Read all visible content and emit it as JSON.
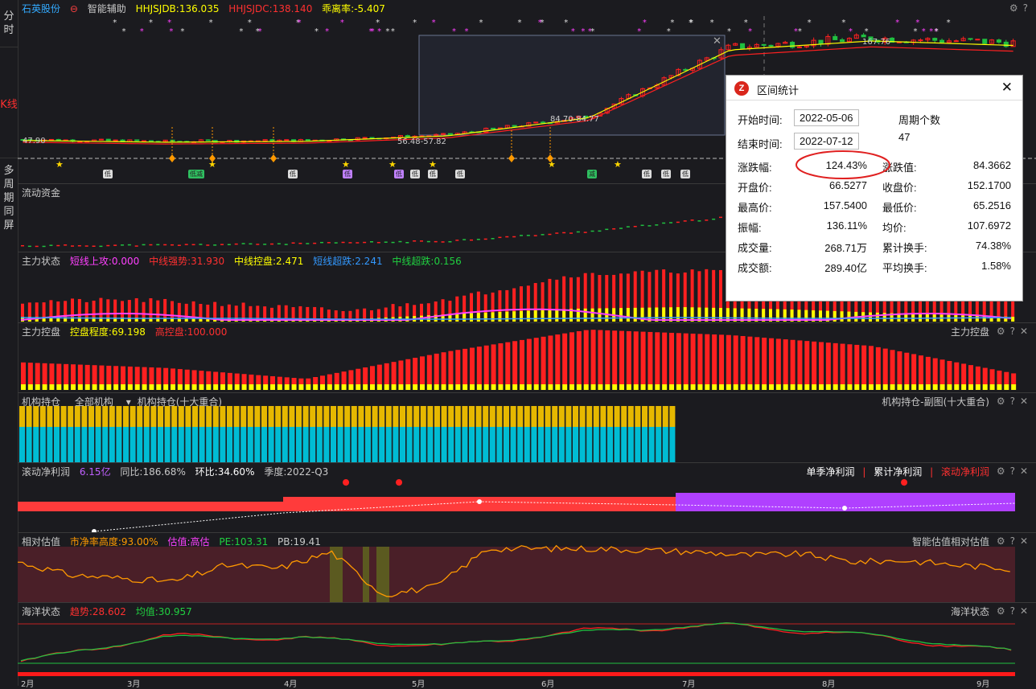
{
  "left_nav": [
    "分时",
    "K线",
    "多周期同屏"
  ],
  "kline": {
    "stock_name": "石英股份",
    "assist_label": "智能辅助",
    "ind1": "HHJSJDB:136.035",
    "ind2": "HHJSJDC:138.140",
    "ind3": "乖离率:-5.407",
    "price_labels": [
      "47.90",
      "56.48-57.82",
      "84.70-84.77",
      "167.76"
    ],
    "badges": [
      "低",
      "低减",
      "低",
      "低",
      "低",
      "低",
      "低",
      "低",
      "减",
      "低",
      "低",
      "低"
    ]
  },
  "flow": {
    "title": "流动资金"
  },
  "main_state": {
    "title": "主力状态",
    "items": [
      "短线上攻:0.000",
      "中线强势:31.930",
      "中线控盘:2.471",
      "短线超跌:2.241",
      "中线超跌:0.156"
    ]
  },
  "control": {
    "title": "主力控盘",
    "items": [
      "控盘程度:69.198",
      "高控盘:100.000"
    ],
    "right_title": "主力控盘"
  },
  "inst": {
    "title": "机构持仓",
    "filter": "全部机构",
    "dropdown": "机构持仓(十大重合)",
    "right_title": "机构持仓-副图(十大重合)"
  },
  "profit": {
    "title": "滚动净利润",
    "value": "6.15亿",
    "yoy": "同比:186.68%",
    "qoq": "环比:34.60%",
    "season": "季度:2022-Q3",
    "tabs": [
      "单季净利润",
      "累计净利润",
      "滚动净利润"
    ]
  },
  "valuation": {
    "title": "相对估值",
    "items": [
      "市净率高度:93.00%",
      "估值:高估",
      "PE:103.31",
      "PB:19.41"
    ],
    "right_title": "智能估值相对估值"
  },
  "ocean": {
    "title": "海洋状态",
    "items": [
      "趋势:28.602",
      "均值:30.957"
    ],
    "right_title": "海洋状态"
  },
  "x_axis": [
    "2月",
    "3月",
    "4月",
    "5月",
    "6月",
    "7月",
    "8月",
    "9月"
  ],
  "popup": {
    "title": "区间统计",
    "start_label": "开始时间:",
    "start": "2022-05-06",
    "end_label": "结束时间:",
    "end": "2022-07-12",
    "period_label": "周期个数",
    "period": "47",
    "rows": [
      [
        "涨跌幅:",
        "124.43%",
        "涨跌值:",
        "84.3662"
      ],
      [
        "开盘价:",
        "66.5277",
        "收盘价:",
        "152.1700"
      ],
      [
        "最高价:",
        "157.5400",
        "最低价:",
        "65.2516"
      ],
      [
        "振幅:",
        "136.11%",
        "均价:",
        "107.6972"
      ],
      [
        "成交量:",
        "268.71万",
        "累计换手:",
        "74.38%"
      ],
      [
        "成交额:",
        "289.40亿",
        "平均换手:",
        "1.58%"
      ]
    ]
  },
  "colors": {
    "up": "#ff2020",
    "down": "#20c040",
    "yellow": "#ffff00",
    "magenta": "#ff40ff",
    "cyan": "#00bcd4",
    "gold": "#e6b800",
    "purple": "#b040ff"
  },
  "chart_data": [
    {
      "type": "line",
      "title": "石英股份",
      "x": [
        "2月",
        "3月",
        "4月",
        "5月",
        "6月",
        "7月",
        "8月",
        "9月"
      ],
      "series": [
        {
          "name": "HHJSJDB",
          "values": [
            50,
            48,
            49,
            55,
            75,
            150,
            160,
            155
          ]
        }
      ]
    },
    {
      "type": "bar",
      "title": "主力控盘",
      "series": [
        {
          "name": "控盘程度",
          "values": [
            40,
            30,
            10,
            60,
            100,
            90,
            70,
            20
          ]
        }
      ]
    },
    {
      "type": "line",
      "title": "海洋状态",
      "series": [
        {
          "name": "趋势",
          "values": [
            10,
            60,
            55,
            40,
            70,
            80,
            60,
            30
          ]
        },
        {
          "name": "均值",
          "values": [
            12,
            58,
            56,
            42,
            68,
            82,
            62,
            32
          ]
        }
      ]
    }
  ]
}
